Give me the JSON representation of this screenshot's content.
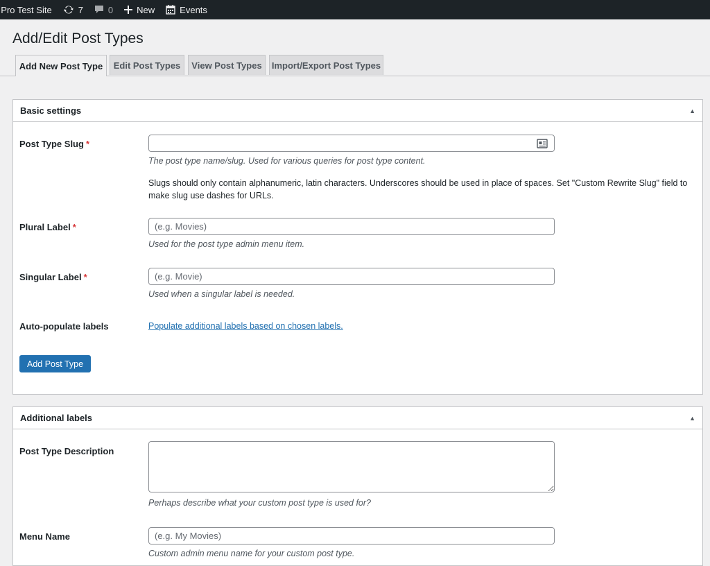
{
  "adminbar": {
    "site_name": "t Pro Test Site",
    "updates_count": "7",
    "comments_count": "0",
    "new_label": "New",
    "events_label": "Events"
  },
  "page": {
    "title": "Add/Edit Post Types"
  },
  "tabs": [
    {
      "label": "Add New Post Type",
      "active": true
    },
    {
      "label": "Edit Post Types",
      "active": false
    },
    {
      "label": "View Post Types",
      "active": false
    },
    {
      "label": "Import/Export Post Types",
      "active": false
    }
  ],
  "basic_settings": {
    "heading": "Basic settings",
    "slug": {
      "label": "Post Type Slug",
      "required": "*",
      "value": "",
      "help": "The post type name/slug. Used for various queries for post type content.",
      "note": "Slugs should only contain alphanumeric, latin characters. Underscores should be used in place of spaces. Set \"Custom Rewrite Slug\" field to make slug use dashes for URLs."
    },
    "plural": {
      "label": "Plural Label",
      "required": "*",
      "placeholder": "(e.g. Movies)",
      "help": "Used for the post type admin menu item."
    },
    "singular": {
      "label": "Singular Label",
      "required": "*",
      "placeholder": "(e.g. Movie)",
      "help": "Used when a singular label is needed."
    },
    "autopopulate": {
      "label": "Auto-populate labels",
      "link": "Populate additional labels based on chosen labels."
    },
    "submit_label": "Add Post Type"
  },
  "additional_labels": {
    "heading": "Additional labels",
    "description": {
      "label": "Post Type Description",
      "help": "Perhaps describe what your custom post type is used for?"
    },
    "menu_name": {
      "label": "Menu Name",
      "placeholder": "(e.g. My Movies)",
      "help": "Custom admin menu name for your custom post type."
    }
  },
  "colors": {
    "admin_bar": "#1d2327",
    "primary": "#2271b1",
    "required": "#d63638",
    "background": "#f0f0f1"
  }
}
